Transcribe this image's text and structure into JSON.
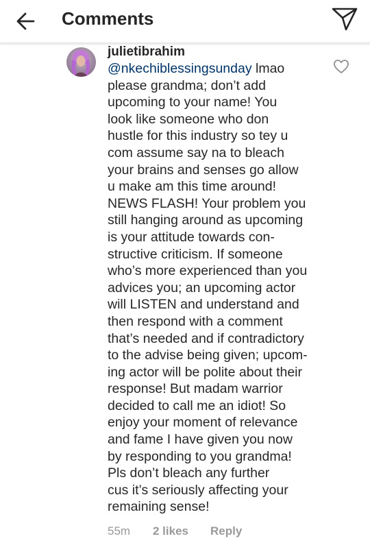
{
  "header": {
    "title": "Comments",
    "back_icon": "arrow-left-icon",
    "send_icon": "paper-plane-icon"
  },
  "comment": {
    "username": "julietibrahim",
    "mention": "@nkechiblessingsunday",
    "text_lines": [
      " lmao",
      "please grandma; don’t add",
      "upcoming to your name! You",
      "look like someone who don",
      "hustle for this industry so tey u",
      "com assume say na to bleach",
      "your brains and senses go allow",
      "u make am this time around!",
      "NEWS FLASH! Your problem you",
      "still hanging around as upcoming",
      "is your attitude towards con-",
      "structive criticism. If someone",
      "who’s more experienced than you",
      "advices you; an upcoming actor",
      "will LISTEN and understand and",
      "then respond with a comment",
      "that’s needed and if contradictory",
      "to the advise being given; upcom-",
      "ing actor will be polite about their",
      "response! But madam warrior",
      "decided to call me an idiot! So",
      "enjoy your moment of relevance",
      "and fame I have given you now",
      "by responding to you grandma!",
      "Pls don’t bleach any further",
      "cus it’s seriously affecting your",
      "remaining sense!"
    ],
    "time": "55m",
    "likes": "2 likes",
    "reply": "Reply",
    "like_icon": "heart-outline-icon"
  },
  "colors": {
    "text": "#262626",
    "mention": "#003569",
    "meta": "#999999",
    "divider": "#e3e3e3"
  }
}
